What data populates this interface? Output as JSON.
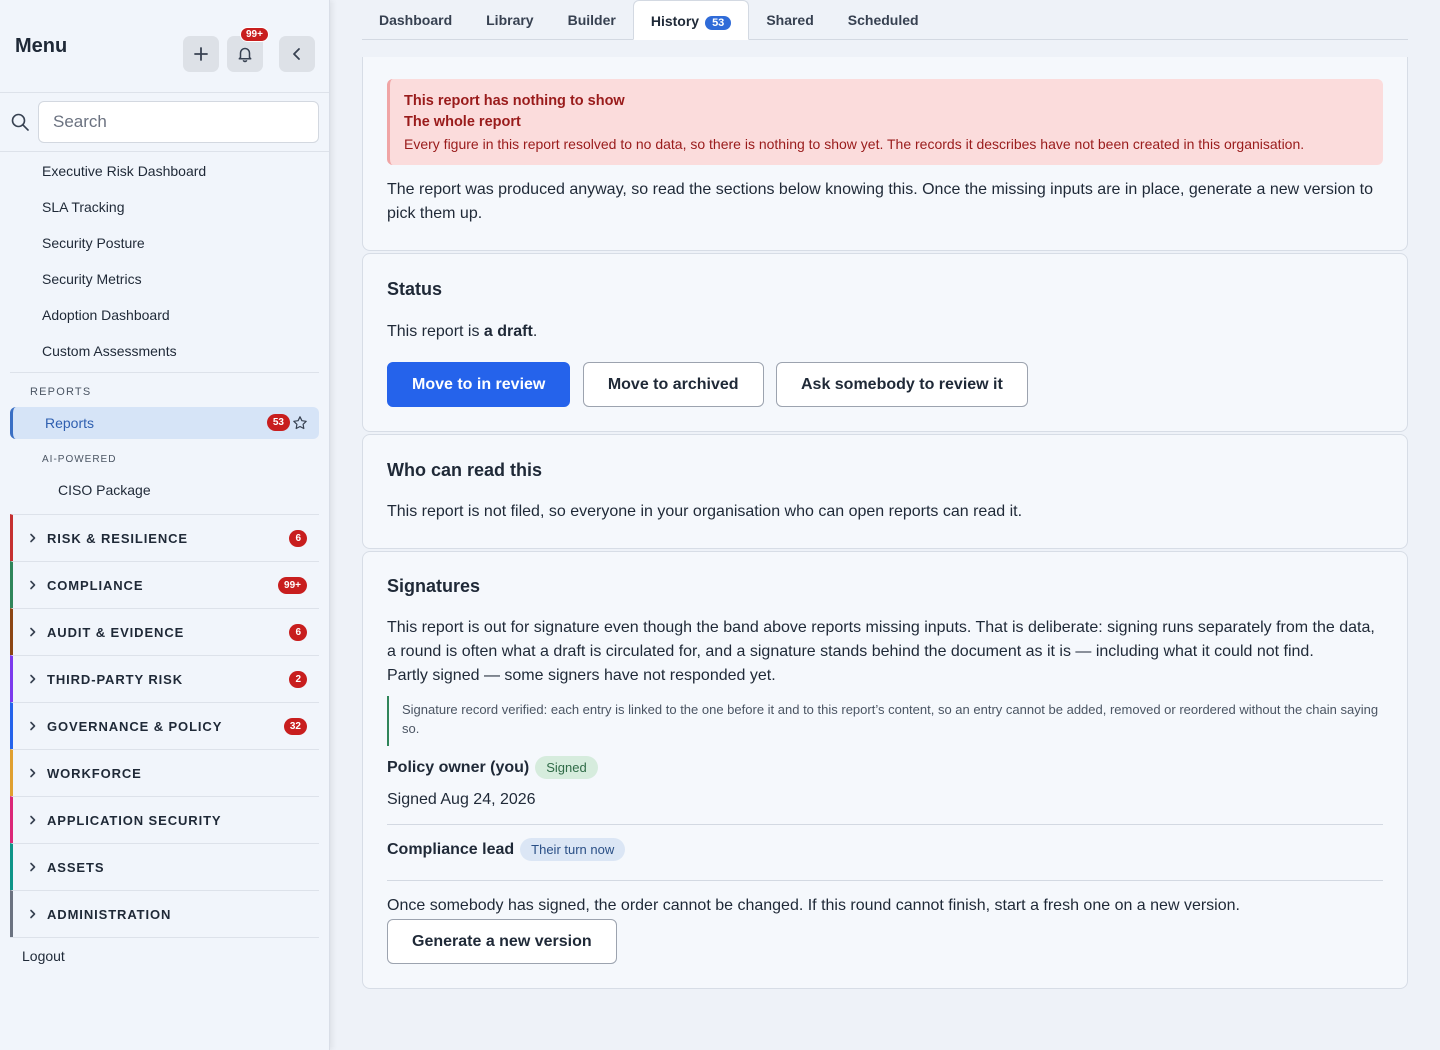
{
  "sidebar": {
    "title": "Menu",
    "notification_count": "99+",
    "search_placeholder": "Search",
    "items": [
      "Executive Risk Dashboard",
      "SLA Tracking",
      "Security Posture",
      "Security Metrics",
      "Adoption Dashboard",
      "Custom Assessments"
    ],
    "reports_section": "REPORTS",
    "reports_item": "Reports",
    "reports_count": "53",
    "ai_label": "AI-POWERED",
    "ai_item": "CISO Package",
    "groups": [
      {
        "label": "RISK & RESILIENCE",
        "count": "6",
        "color": "#c53030"
      },
      {
        "label": "COMPLIANCE",
        "count": "99+",
        "color": "#2f855a"
      },
      {
        "label": "AUDIT & EVIDENCE",
        "count": "6",
        "color": "#8b4513"
      },
      {
        "label": "THIRD-PARTY RISK",
        "count": "2",
        "color": "#7c3aed"
      },
      {
        "label": "GOVERNANCE & POLICY",
        "count": "32",
        "color": "#2563eb"
      },
      {
        "label": "WORKFORCE",
        "count": "",
        "color": "#e0a030"
      },
      {
        "label": "APPLICATION SECURITY",
        "count": "",
        "color": "#db2777"
      },
      {
        "label": "ASSETS",
        "count": "",
        "color": "#0f9488"
      },
      {
        "label": "ADMINISTRATION",
        "count": "",
        "color": "#6b7280"
      }
    ],
    "logout": "Logout"
  },
  "tabs": {
    "dashboard": "Dashboard",
    "library": "Library",
    "builder": "Builder",
    "history": "History",
    "history_count": "53",
    "shared": "Shared",
    "scheduled": "Scheduled"
  },
  "alert": {
    "title": "This report has nothing to show",
    "subtitle": "The whole report",
    "body": "Every figure in this report resolved to no data, so there is nothing to show yet. The records it describes have not been created in this organisation."
  },
  "intro_text": "The report was produced anyway, so read the sections below knowing this. Once the missing inputs are in place, generate a new version to pick them up.",
  "status": {
    "title": "Status",
    "text_prefix": "This report is ",
    "text_bold": "a draft",
    "text_suffix": ".",
    "btn_review": "Move to in review",
    "btn_archive": "Move to archived",
    "btn_ask": "Ask somebody to review it"
  },
  "access": {
    "title": "Who can read this",
    "text": "This report is not filed, so everyone in your organisation who can open reports can read it."
  },
  "signatures": {
    "title": "Signatures",
    "text1": "This report is out for signature even though the band above reports missing inputs. That is deliberate: signing runs separately from the data, a round is often what a draft is circulated for, and a signature stands behind the document as it is — including what it could not find.",
    "text2": "Partly signed — some signers have not responded yet.",
    "verify": "Signature record verified: each entry is linked to the one before it and to this report’s content, so an entry cannot be added, removed or reordered without the chain saying so.",
    "signer1_name": "Policy owner (you)",
    "signer1_status": "Signed",
    "signer1_date": "Signed Aug 24, 2026",
    "signer2_name": "Compliance lead",
    "signer2_status": "Their turn now",
    "footer": "Once somebody has signed, the order cannot be changed. If this round cannot finish, start a fresh one on a new version.",
    "btn_new": "Generate a new version"
  }
}
